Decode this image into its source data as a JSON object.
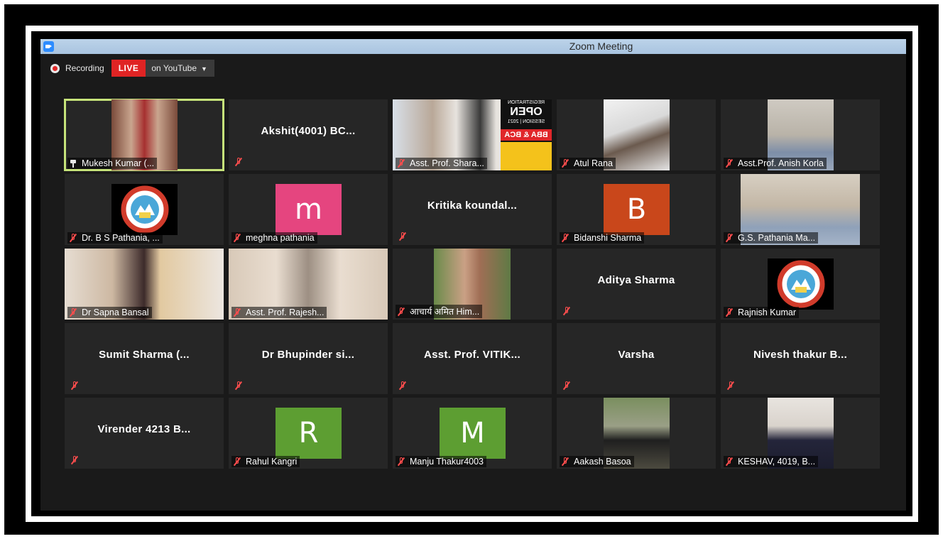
{
  "window": {
    "title": "Zoom Meeting"
  },
  "recording": {
    "label": "Recording",
    "live_label": "LIVE",
    "platform_label": "on YouTube"
  },
  "participants": [
    {
      "name": "Mukesh Kumar (...",
      "kind": "video",
      "active": true,
      "pinned": true
    },
    {
      "name": "Akshit(4001) BC...",
      "kind": "name"
    },
    {
      "name": "Asst. Prof. Shara...",
      "kind": "video",
      "poster": {
        "line1": "REGISTRATION",
        "line2": "OPEN",
        "line3": "SESSION | 2021",
        "line4": "BBA & BCA"
      }
    },
    {
      "name": "Atul Rana",
      "kind": "video"
    },
    {
      "name": "Asst.Prof. Anish Korla",
      "kind": "video"
    },
    {
      "name": "Dr. B S Pathania, ...",
      "kind": "logo",
      "logo_text": "DRONACHARYA COLLEGE"
    },
    {
      "name": "meghna pathania",
      "kind": "letter",
      "letter": "m",
      "color": "#e5457f"
    },
    {
      "name": "Kritika  koundal...",
      "kind": "name"
    },
    {
      "name": "Bidanshi Sharma",
      "kind": "letter",
      "letter": "B",
      "color": "#c9471b"
    },
    {
      "name": "G.S. Pathania Ma...",
      "kind": "video"
    },
    {
      "name": "Dr Sapna Bansal",
      "kind": "video"
    },
    {
      "name": "Asst. Prof. Rajesh...",
      "kind": "video"
    },
    {
      "name": "आचार्य अमित Him...",
      "kind": "video"
    },
    {
      "name": "Aditya Sharma",
      "kind": "name"
    },
    {
      "name": "Rajnish Kumar",
      "kind": "logo",
      "logo_text": "DRONACHARYA COLLEGE"
    },
    {
      "name": "Sumit Sharma (...",
      "kind": "name"
    },
    {
      "name": "Dr Bhupinder si...",
      "kind": "name"
    },
    {
      "name": "Asst. Prof. VITIK...",
      "kind": "name"
    },
    {
      "name": "Varsha",
      "kind": "name"
    },
    {
      "name": "Nivesh thakur B...",
      "kind": "name"
    },
    {
      "name": "Virender 4213 B...",
      "kind": "name"
    },
    {
      "name": "Rahul Kangri",
      "kind": "letter",
      "letter": "R",
      "color": "#5d9e32"
    },
    {
      "name": "Manju Thakur4003",
      "kind": "letter",
      "letter": "M",
      "color": "#5d9e32"
    },
    {
      "name": "Aakash Basoa",
      "kind": "video"
    },
    {
      "name": "KESHAV, 4019, B...",
      "kind": "video"
    }
  ],
  "colors": {
    "live_red": "#e02424",
    "active_border": "#c6e37a",
    "tile_bg": "#262626",
    "mute_red": "#ff4d4d"
  }
}
